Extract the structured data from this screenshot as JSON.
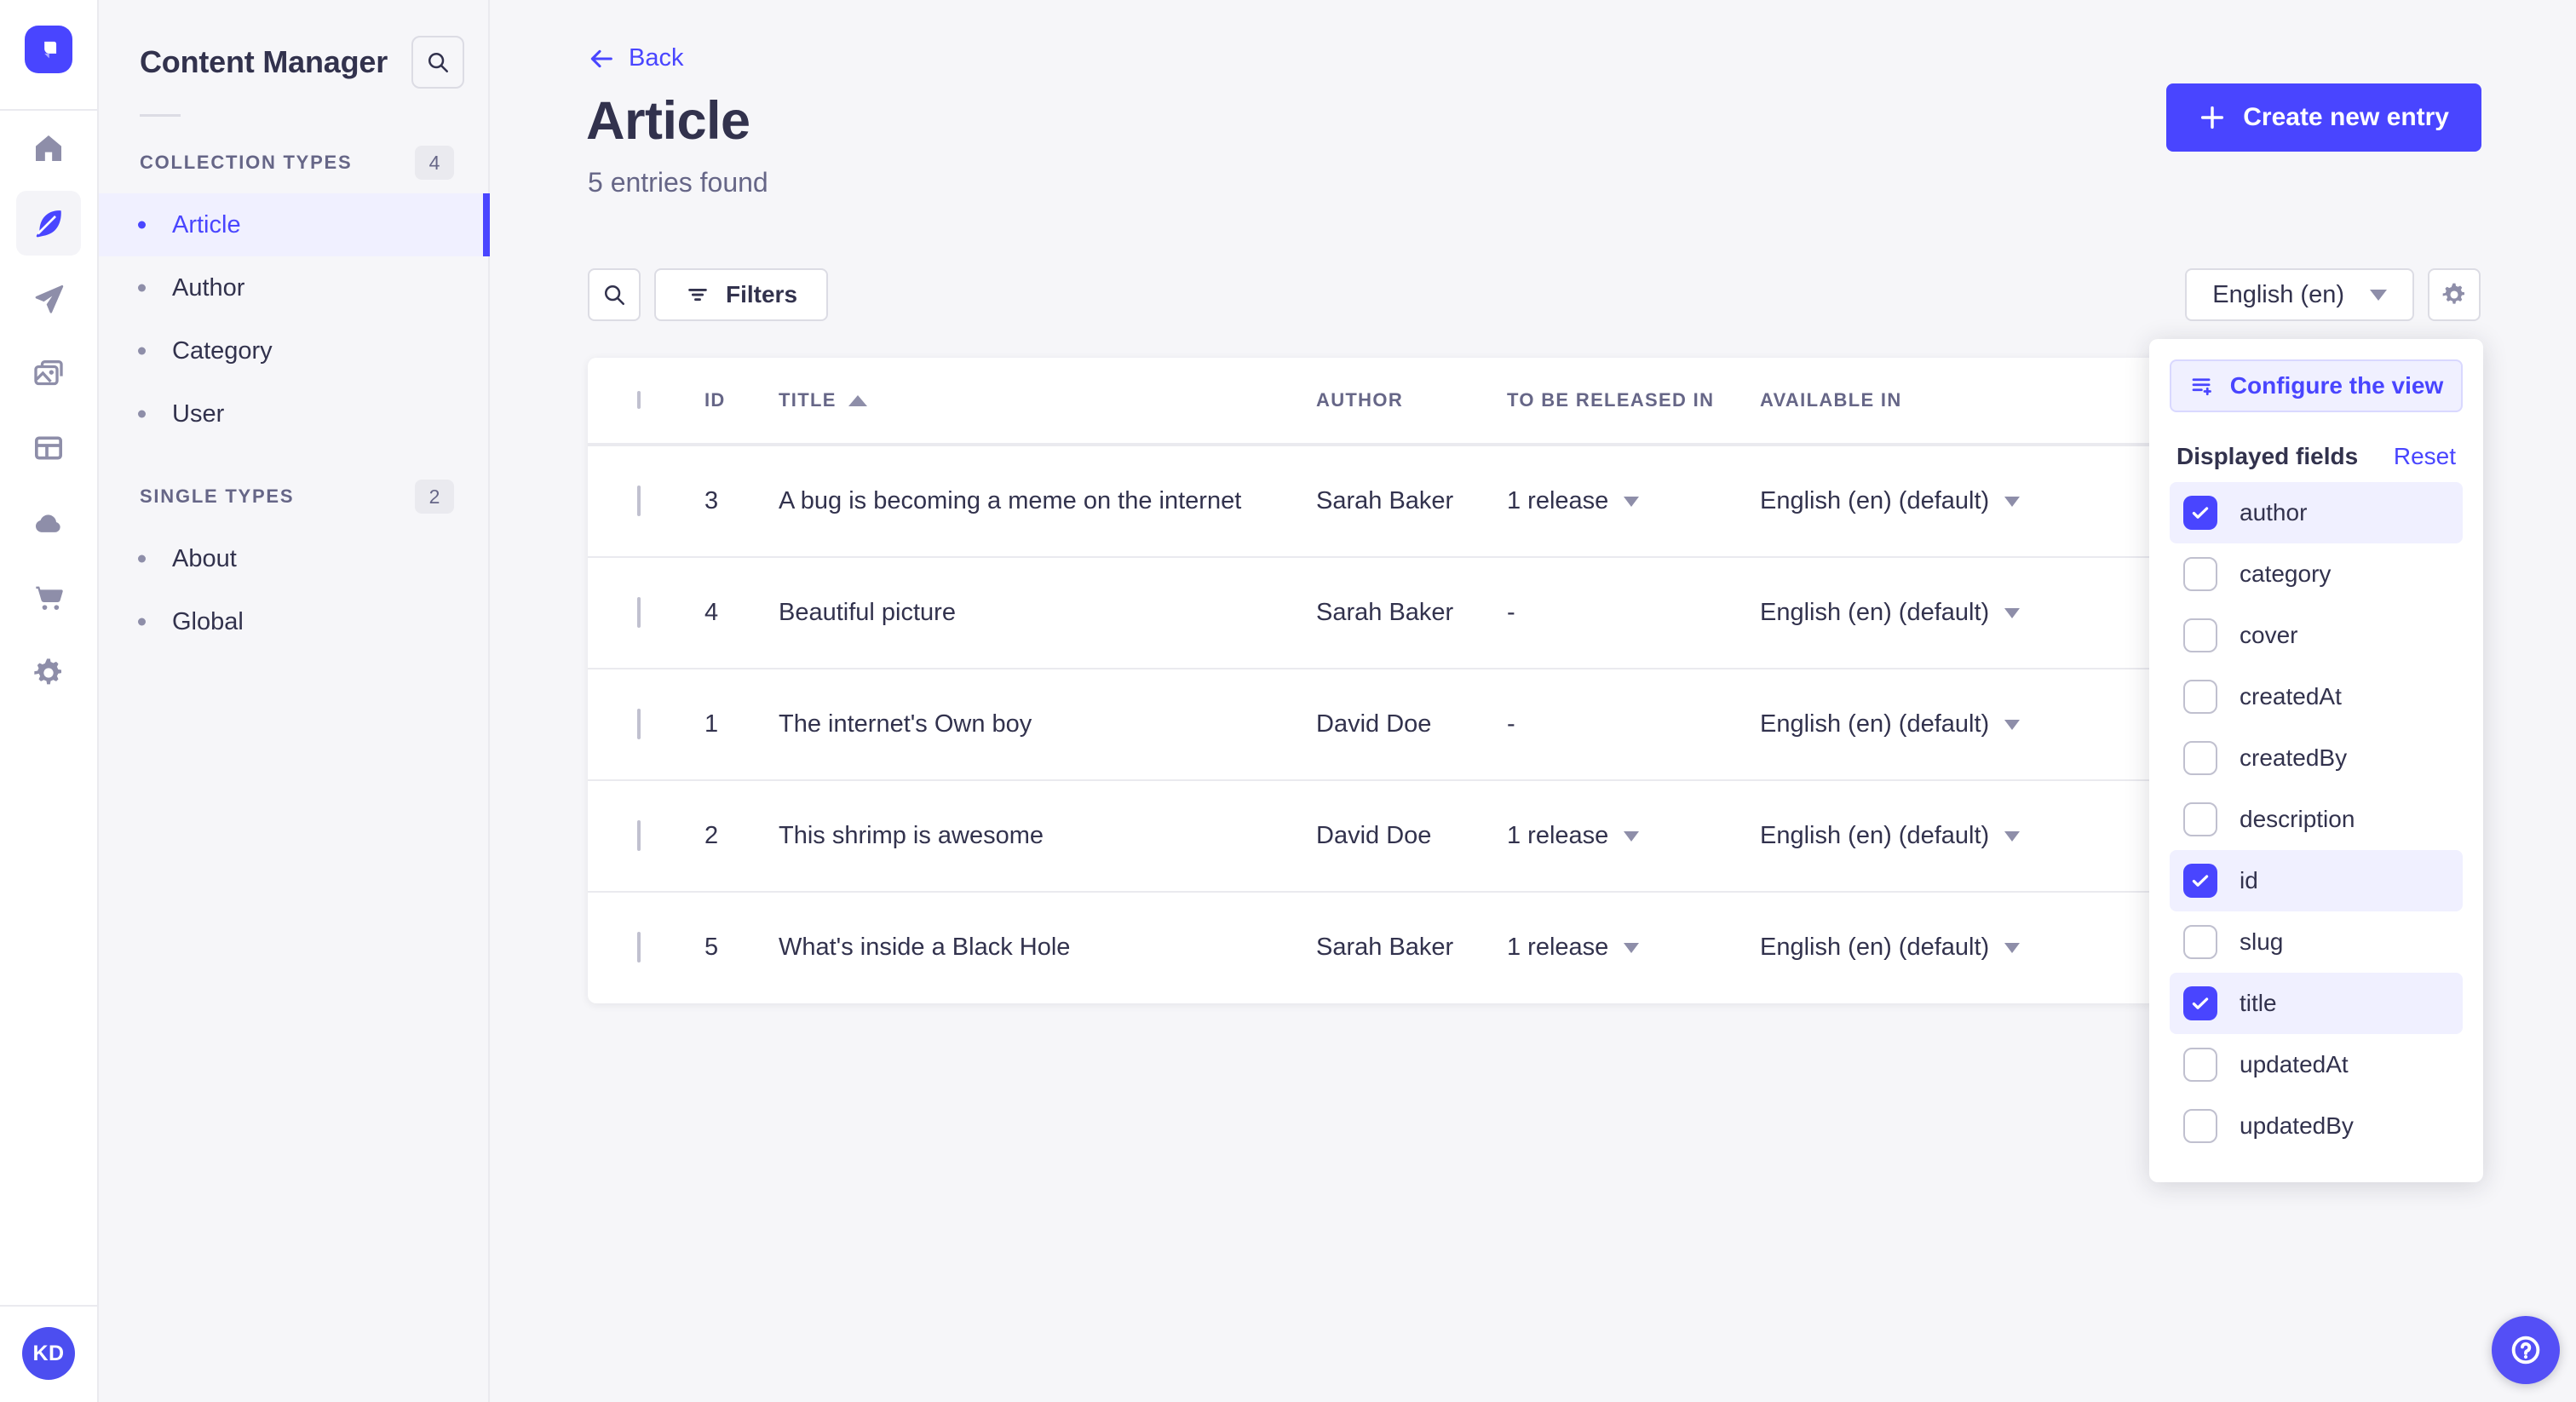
{
  "sidebar": {
    "title": "Content Manager",
    "sections": [
      {
        "label": "COLLECTION TYPES",
        "badge": "4",
        "items": [
          {
            "label": "Article"
          },
          {
            "label": "Author"
          },
          {
            "label": "Category"
          },
          {
            "label": "User"
          }
        ]
      },
      {
        "label": "SINGLE TYPES",
        "badge": "2",
        "items": [
          {
            "label": "About"
          },
          {
            "label": "Global"
          }
        ]
      }
    ]
  },
  "header": {
    "back": "Back",
    "title": "Article",
    "subtitle": "5 entries found",
    "create": "Create new entry"
  },
  "toolbar": {
    "filters": "Filters",
    "locale": "English (en)"
  },
  "table": {
    "columns": {
      "id": "ID",
      "title": "TITLE",
      "author": "AUTHOR",
      "release": "TO BE RELEASED IN",
      "available": "AVAILABLE IN"
    },
    "sort": {
      "column": "TITLE",
      "direction": "ascending"
    },
    "rows": [
      {
        "id": "3",
        "title": "A bug is becoming a meme on the internet",
        "author": "Sarah Baker",
        "release": "1 release",
        "available": "English (en) (default)"
      },
      {
        "id": "4",
        "title": "Beautiful picture",
        "author": "Sarah Baker",
        "release": "-",
        "available": "English (en) (default)"
      },
      {
        "id": "1",
        "title": "The internet's Own boy",
        "author": "David Doe",
        "release": "-",
        "available": "English (en) (default)"
      },
      {
        "id": "2",
        "title": "This shrimp is awesome",
        "author": "David Doe",
        "release": "1 release",
        "available": "English (en) (default)"
      },
      {
        "id": "5",
        "title": "What's inside a Black Hole",
        "author": "Sarah Baker",
        "release": "1 release",
        "available": "English (en) (default)"
      }
    ]
  },
  "popover": {
    "configure": "Configure the view",
    "fields_title": "Displayed fields",
    "reset": "Reset",
    "fields": [
      {
        "label": "author",
        "checked": true
      },
      {
        "label": "category",
        "checked": false
      },
      {
        "label": "cover",
        "checked": false
      },
      {
        "label": "createdAt",
        "checked": false
      },
      {
        "label": "createdBy",
        "checked": false
      },
      {
        "label": "description",
        "checked": false
      },
      {
        "label": "id",
        "checked": true
      },
      {
        "label": "slug",
        "checked": false
      },
      {
        "label": "title",
        "checked": true
      },
      {
        "label": "updatedAt",
        "checked": false
      },
      {
        "label": "updatedBy",
        "checked": false
      }
    ]
  },
  "user": {
    "initials": "KD"
  },
  "colors": {
    "accent": "#4945ff",
    "accent_light": "#f0f0ff",
    "text": "#32324d",
    "muted": "#666687",
    "border": "#dcdce4",
    "background": "#f6f6f9"
  }
}
